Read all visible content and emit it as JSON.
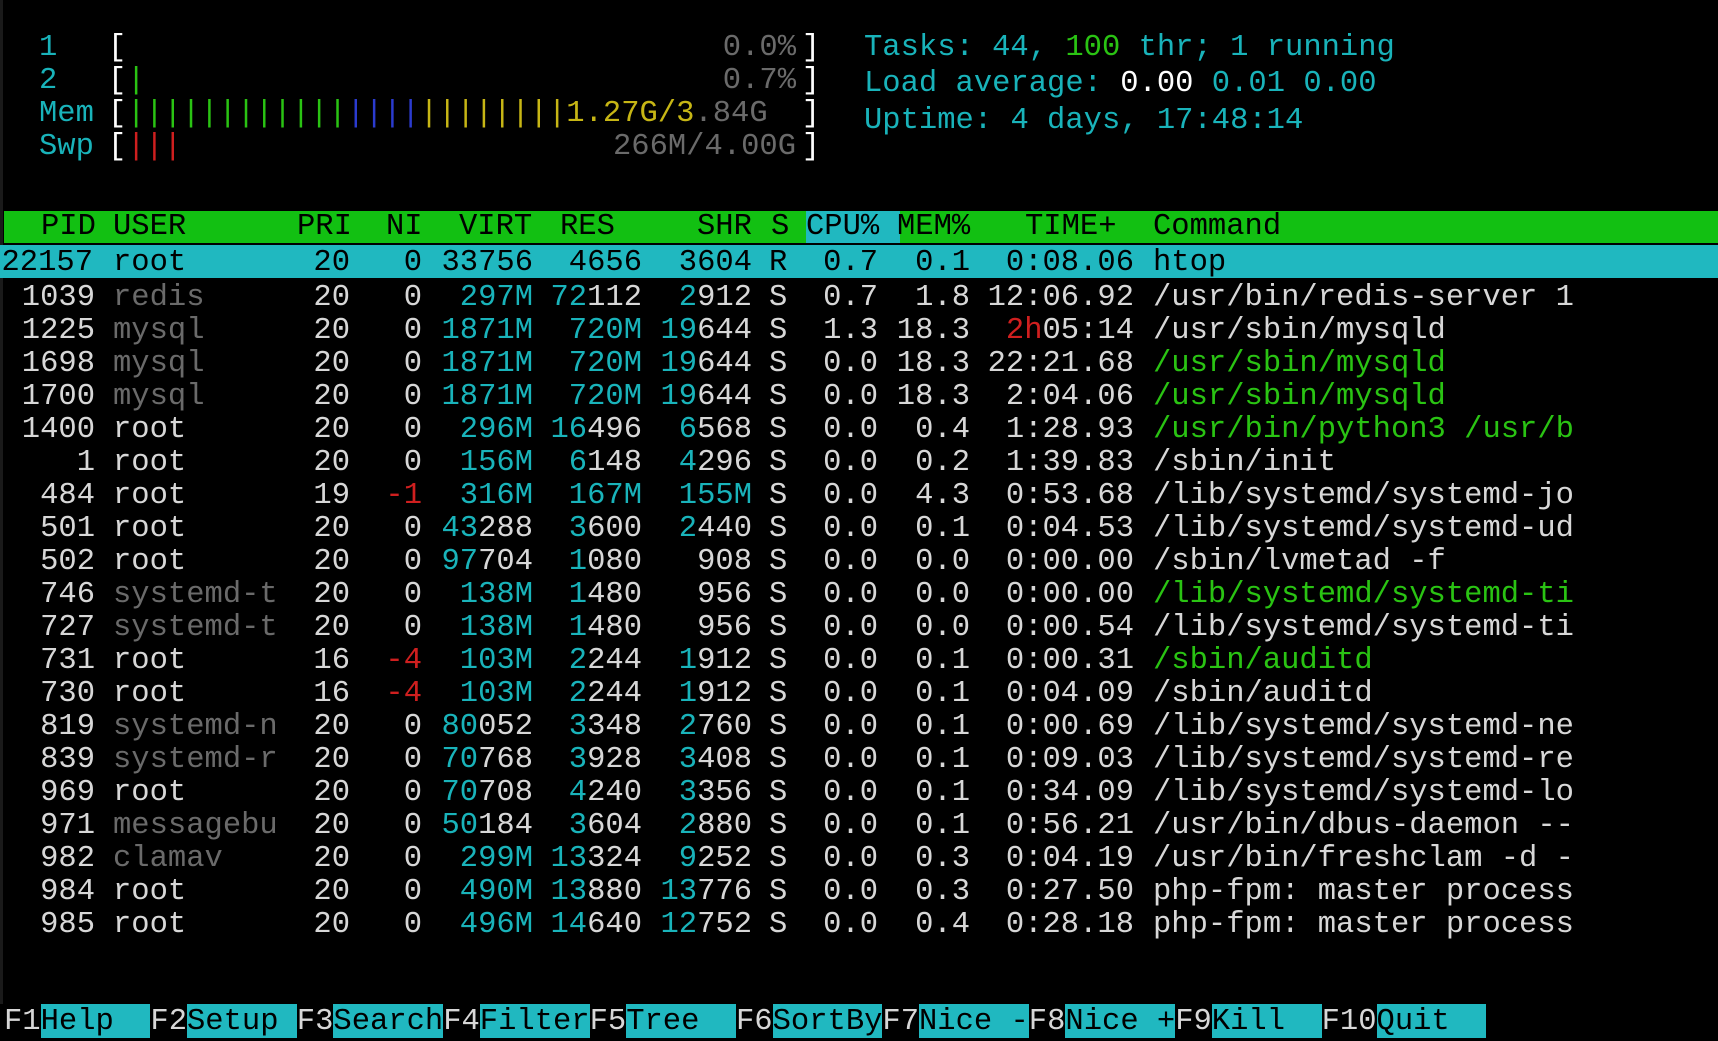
{
  "meters": {
    "cpu1": {
      "label": "1",
      "bars": "",
      "value": "0.0%"
    },
    "cpu2": {
      "label": "2",
      "bars": "|",
      "value": "0.7%"
    },
    "mem": {
      "label": "Mem",
      "bars_green": "||||||||||||",
      "bars_blue": "||||",
      "bars_yellow": "||||||||",
      "value_y": "1.27G/3",
      "value_g": ".84G"
    },
    "swp": {
      "label": "Swp",
      "bars_red": "|||",
      "value": "266M/4.00G"
    },
    "open_bracket": "[",
    "close_bracket": "]"
  },
  "info": {
    "tasks_label": "Tasks: ",
    "tasks_count": "44",
    "tasks_sep": ", ",
    "threads": "100",
    "threads_label": " thr; ",
    "running": "1",
    "running_label": " running",
    "load_label": "Load average: ",
    "load1": "0.00",
    "load5": "0.01",
    "load15": "0.00",
    "uptime_label": "Uptime: ",
    "uptime_value": "4 days, 17:48:14"
  },
  "header": {
    "pid": "PID",
    "user": "USER",
    "pri": "PRI",
    "ni": "NI",
    "virt": "VIRT",
    "res": "RES",
    "shr": "SHR",
    "s": "S",
    "cpu": "CPU%",
    "mem": "MEM%",
    "time": "TIME+",
    "command": "Command"
  },
  "processes": [
    {
      "pid": "22157",
      "user": "root",
      "pri": "20",
      "ni": "0",
      "virt": "33756",
      "res": "4656",
      "shr": "3604",
      "s": "R",
      "cpu": "0.7",
      "mem": "0.1",
      "time": "0:08.06",
      "command": "htop",
      "selected": true
    },
    {
      "pid": "1039",
      "user": "redis",
      "pri": "20",
      "ni": "0",
      "virt": "297M",
      "res": "72112",
      "shr": "2912",
      "s": "S",
      "cpu": "0.7",
      "mem": "1.8",
      "time": "12:06.92",
      "command": "/usr/bin/redis-server 1"
    },
    {
      "pid": "1225",
      "user": "mysql",
      "pri": "20",
      "ni": "0",
      "virt": "1871M",
      "res": "720M",
      "shr": "19644",
      "s": "S",
      "cpu": "1.3",
      "mem": "18.3",
      "time_h": "2h",
      "time": "05:14",
      "command": "/usr/sbin/mysqld"
    },
    {
      "pid": "1698",
      "user": "mysql",
      "pri": "20",
      "ni": "0",
      "virt": "1871M",
      "res": "720M",
      "shr": "19644",
      "s": "S",
      "cpu": "0.0",
      "mem": "18.3",
      "time": "22:21.68",
      "command": "/usr/sbin/mysqld",
      "thread": true
    },
    {
      "pid": "1700",
      "user": "mysql",
      "pri": "20",
      "ni": "0",
      "virt": "1871M",
      "res": "720M",
      "shr": "19644",
      "s": "S",
      "cpu": "0.0",
      "mem": "18.3",
      "time": "2:04.06",
      "command": "/usr/sbin/mysqld",
      "thread": true
    },
    {
      "pid": "1400",
      "user": "root",
      "pri": "20",
      "ni": "0",
      "virt": "296M",
      "res": "16496",
      "shr": "6568",
      "s": "S",
      "cpu": "0.0",
      "mem": "0.4",
      "time": "1:28.93",
      "command": "/usr/bin/python3 /usr/b",
      "thread": true
    },
    {
      "pid": "1",
      "user": "root",
      "pri": "20",
      "ni": "0",
      "virt": "156M",
      "res": "6148",
      "shr": "4296",
      "s": "S",
      "cpu": "0.0",
      "mem": "0.2",
      "time": "1:39.83",
      "command": "/sbin/init"
    },
    {
      "pid": "484",
      "user": "root",
      "pri": "19",
      "ni": "-1",
      "virt": "316M",
      "res": "167M",
      "shr": "155M",
      "s": "S",
      "cpu": "0.0",
      "mem": "4.3",
      "time": "0:53.68",
      "command": "/lib/systemd/systemd-jo"
    },
    {
      "pid": "501",
      "user": "root",
      "pri": "20",
      "ni": "0",
      "virt": "43288",
      "res": "3600",
      "shr": "2440",
      "s": "S",
      "cpu": "0.0",
      "mem": "0.1",
      "time": "0:04.53",
      "command": "/lib/systemd/systemd-ud"
    },
    {
      "pid": "502",
      "user": "root",
      "pri": "20",
      "ni": "0",
      "virt": "97704",
      "res": "1080",
      "shr": "908",
      "s": "S",
      "cpu": "0.0",
      "mem": "0.0",
      "time": "0:00.00",
      "command": "/sbin/lvmetad -f"
    },
    {
      "pid": "746",
      "user": "systemd-t",
      "pri": "20",
      "ni": "0",
      "virt": "138M",
      "res": "1480",
      "shr": "956",
      "s": "S",
      "cpu": "0.0",
      "mem": "0.0",
      "time": "0:00.00",
      "command": "/lib/systemd/systemd-ti",
      "thread": true
    },
    {
      "pid": "727",
      "user": "systemd-t",
      "pri": "20",
      "ni": "0",
      "virt": "138M",
      "res": "1480",
      "shr": "956",
      "s": "S",
      "cpu": "0.0",
      "mem": "0.0",
      "time": "0:00.54",
      "command": "/lib/systemd/systemd-ti"
    },
    {
      "pid": "731",
      "user": "root",
      "pri": "16",
      "ni": "-4",
      "virt": "103M",
      "res": "2244",
      "shr": "1912",
      "s": "S",
      "cpu": "0.0",
      "mem": "0.1",
      "time": "0:00.31",
      "command": "/sbin/auditd",
      "thread": true
    },
    {
      "pid": "730",
      "user": "root",
      "pri": "16",
      "ni": "-4",
      "virt": "103M",
      "res": "2244",
      "shr": "1912",
      "s": "S",
      "cpu": "0.0",
      "mem": "0.1",
      "time": "0:04.09",
      "command": "/sbin/auditd"
    },
    {
      "pid": "819",
      "user": "systemd-n",
      "pri": "20",
      "ni": "0",
      "virt": "80052",
      "res": "3348",
      "shr": "2760",
      "s": "S",
      "cpu": "0.0",
      "mem": "0.1",
      "time": "0:00.69",
      "command": "/lib/systemd/systemd-ne"
    },
    {
      "pid": "839",
      "user": "systemd-r",
      "pri": "20",
      "ni": "0",
      "virt": "70768",
      "res": "3928",
      "shr": "3408",
      "s": "S",
      "cpu": "0.0",
      "mem": "0.1",
      "time": "0:09.03",
      "command": "/lib/systemd/systemd-re"
    },
    {
      "pid": "969",
      "user": "root",
      "pri": "20",
      "ni": "0",
      "virt": "70708",
      "res": "4240",
      "shr": "3356",
      "s": "S",
      "cpu": "0.0",
      "mem": "0.1",
      "time": "0:34.09",
      "command": "/lib/systemd/systemd-lo"
    },
    {
      "pid": "971",
      "user": "messagebu",
      "pri": "20",
      "ni": "0",
      "virt": "50184",
      "res": "3604",
      "shr": "2880",
      "s": "S",
      "cpu": "0.0",
      "mem": "0.1",
      "time": "0:56.21",
      "command": "/usr/bin/dbus-daemon --"
    },
    {
      "pid": "982",
      "user": "clamav",
      "pri": "20",
      "ni": "0",
      "virt": "299M",
      "res": "13324",
      "shr": "9252",
      "s": "S",
      "cpu": "0.0",
      "mem": "0.3",
      "time": "0:04.19",
      "command": "/usr/bin/freshclam -d -"
    },
    {
      "pid": "984",
      "user": "root",
      "pri": "20",
      "ni": "0",
      "virt": "490M",
      "res": "13880",
      "shr": "13776",
      "s": "S",
      "cpu": "0.0",
      "mem": "0.3",
      "time": "0:27.50",
      "command": "php-fpm: master process"
    },
    {
      "pid": "985",
      "user": "root",
      "pri": "20",
      "ni": "0",
      "virt": "496M",
      "res": "14640",
      "shr": "12752",
      "s": "S",
      "cpu": "0.0",
      "mem": "0.4",
      "time": "0:28.18",
      "command": "php-fpm: master process"
    }
  ],
  "footer": [
    {
      "key": "F1",
      "label": "Help  "
    },
    {
      "key": "F2",
      "label": "Setup "
    },
    {
      "key": "F3",
      "label": "Search"
    },
    {
      "key": "F4",
      "label": "Filter"
    },
    {
      "key": "F5",
      "label": "Tree  "
    },
    {
      "key": "F6",
      "label": "SortBy"
    },
    {
      "key": "F7",
      "label": "Nice -"
    },
    {
      "key": "F8",
      "label": "Nice +"
    },
    {
      "key": "F9",
      "label": "Kill  "
    },
    {
      "key": "F10",
      "label": "Quit  "
    }
  ],
  "colors": {
    "background": "#000000",
    "cyan": "#19b3ba",
    "green": "#2ac313",
    "header_bg": "#12c012",
    "selected_bg": "#20b8c0",
    "red": "#cf1f1f",
    "yellow": "#c7b615",
    "blue": "#2b3bcf",
    "gray": "#6a6a6a"
  }
}
